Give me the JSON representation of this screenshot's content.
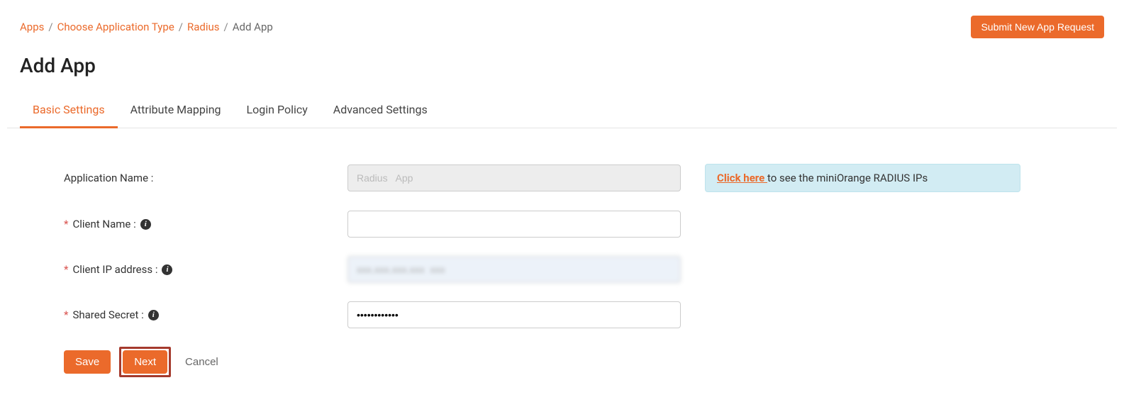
{
  "breadcrumb": {
    "items": [
      "Apps",
      "Choose Application Type",
      "Radius"
    ],
    "current": "Add App"
  },
  "header": {
    "submit_button": "Submit New App Request",
    "page_title": "Add App"
  },
  "tabs": {
    "items": [
      {
        "label": "Basic Settings",
        "active": true
      },
      {
        "label": "Attribute Mapping",
        "active": false
      },
      {
        "label": "Login Policy",
        "active": false
      },
      {
        "label": "Advanced Settings",
        "active": false
      }
    ]
  },
  "form": {
    "application_name": {
      "label": "Application Name :",
      "value": "Radius   App"
    },
    "client_name": {
      "label": "Client Name :",
      "value": ""
    },
    "client_ip": {
      "label": "Client IP address :",
      "value": "xxx.xxx.xxx.xxx  xxx"
    },
    "shared_secret": {
      "label": "Shared Secret :",
      "value": "••••••••••••"
    },
    "info_link_text": "Click here ",
    "info_rest": "to see the miniOrange RADIUS IPs"
  },
  "buttons": {
    "save": "Save",
    "next": "Next",
    "cancel": "Cancel"
  },
  "icons": {
    "info_glyph": "i"
  }
}
